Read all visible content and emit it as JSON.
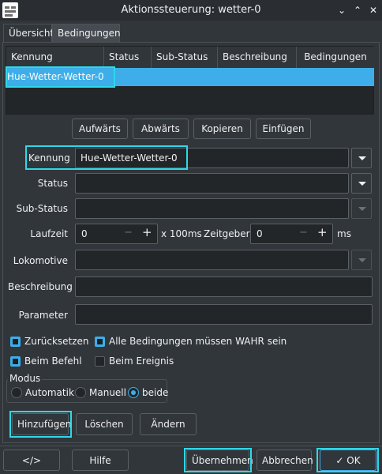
{
  "window": {
    "title": "Aktionssteuerung: wetter-0"
  },
  "tabs": [
    {
      "label": "Übersicht"
    },
    {
      "label": "Bedingungen"
    }
  ],
  "table": {
    "columns": [
      "Kennung",
      "Status",
      "Sub-Status",
      "Beschreibung",
      "Bedingungen"
    ],
    "rows": [
      {
        "kennung": "Hue-Wetter-Wetter-0",
        "status": "",
        "sub_status": "",
        "beschreibung": "",
        "bedingungen": ""
      }
    ]
  },
  "list_buttons": {
    "up": "Aufwärts",
    "down": "Abwärts",
    "copy": "Kopieren",
    "paste": "Einfügen"
  },
  "form": {
    "kennung_label": "Kennung",
    "kennung_value": "Hue-Wetter-Wetter-0",
    "status_label": "Status",
    "status_value": "",
    "substatus_label": "Sub-Status",
    "substatus_value": "",
    "laufzeit_label": "Laufzeit",
    "laufzeit_value": "0",
    "laufzeit_unit": "x 100ms",
    "zeitgeber_label": "Zeitgeber",
    "zeitgeber_value": "0",
    "zeitgeber_unit": "ms",
    "lokomotive_label": "Lokomotive",
    "lokomotive_value": "",
    "beschreibung_label": "Beschreibung",
    "beschreibung_value": "",
    "parameter_label": "Parameter",
    "parameter_value": "",
    "minus": "−",
    "plus": "+"
  },
  "options": {
    "zuruecksetzen": {
      "label": "Zurücksetzen",
      "checked": true
    },
    "alle_wahr": {
      "label": "Alle Bedingungen müssen WAHR sein",
      "checked": true
    },
    "beim_befehl": {
      "label": "Beim Befehl",
      "checked": true
    },
    "beim_ereignis": {
      "label": "Beim Ereignis",
      "checked": false
    }
  },
  "modus": {
    "title": "Modus",
    "options": [
      {
        "label": "Automatik"
      },
      {
        "label": "Manuell"
      },
      {
        "label": "beide"
      }
    ],
    "selected": "beide"
  },
  "action_buttons": {
    "add": "Hinzufügen",
    "delete": "Löschen",
    "change": "Ändern"
  },
  "footer": {
    "code": "</>",
    "help": "Hilfe",
    "apply": "Übernehmen",
    "cancel": "Abbrechen",
    "ok": "OK",
    "ok_icon": "✓"
  },
  "titlebar_icons": {
    "collapse": "⌄",
    "expand": "⌃",
    "close": "✕"
  },
  "colors": {
    "accent": "#3daee9",
    "highlight": "#2ed8e8",
    "background": "#31363b"
  }
}
